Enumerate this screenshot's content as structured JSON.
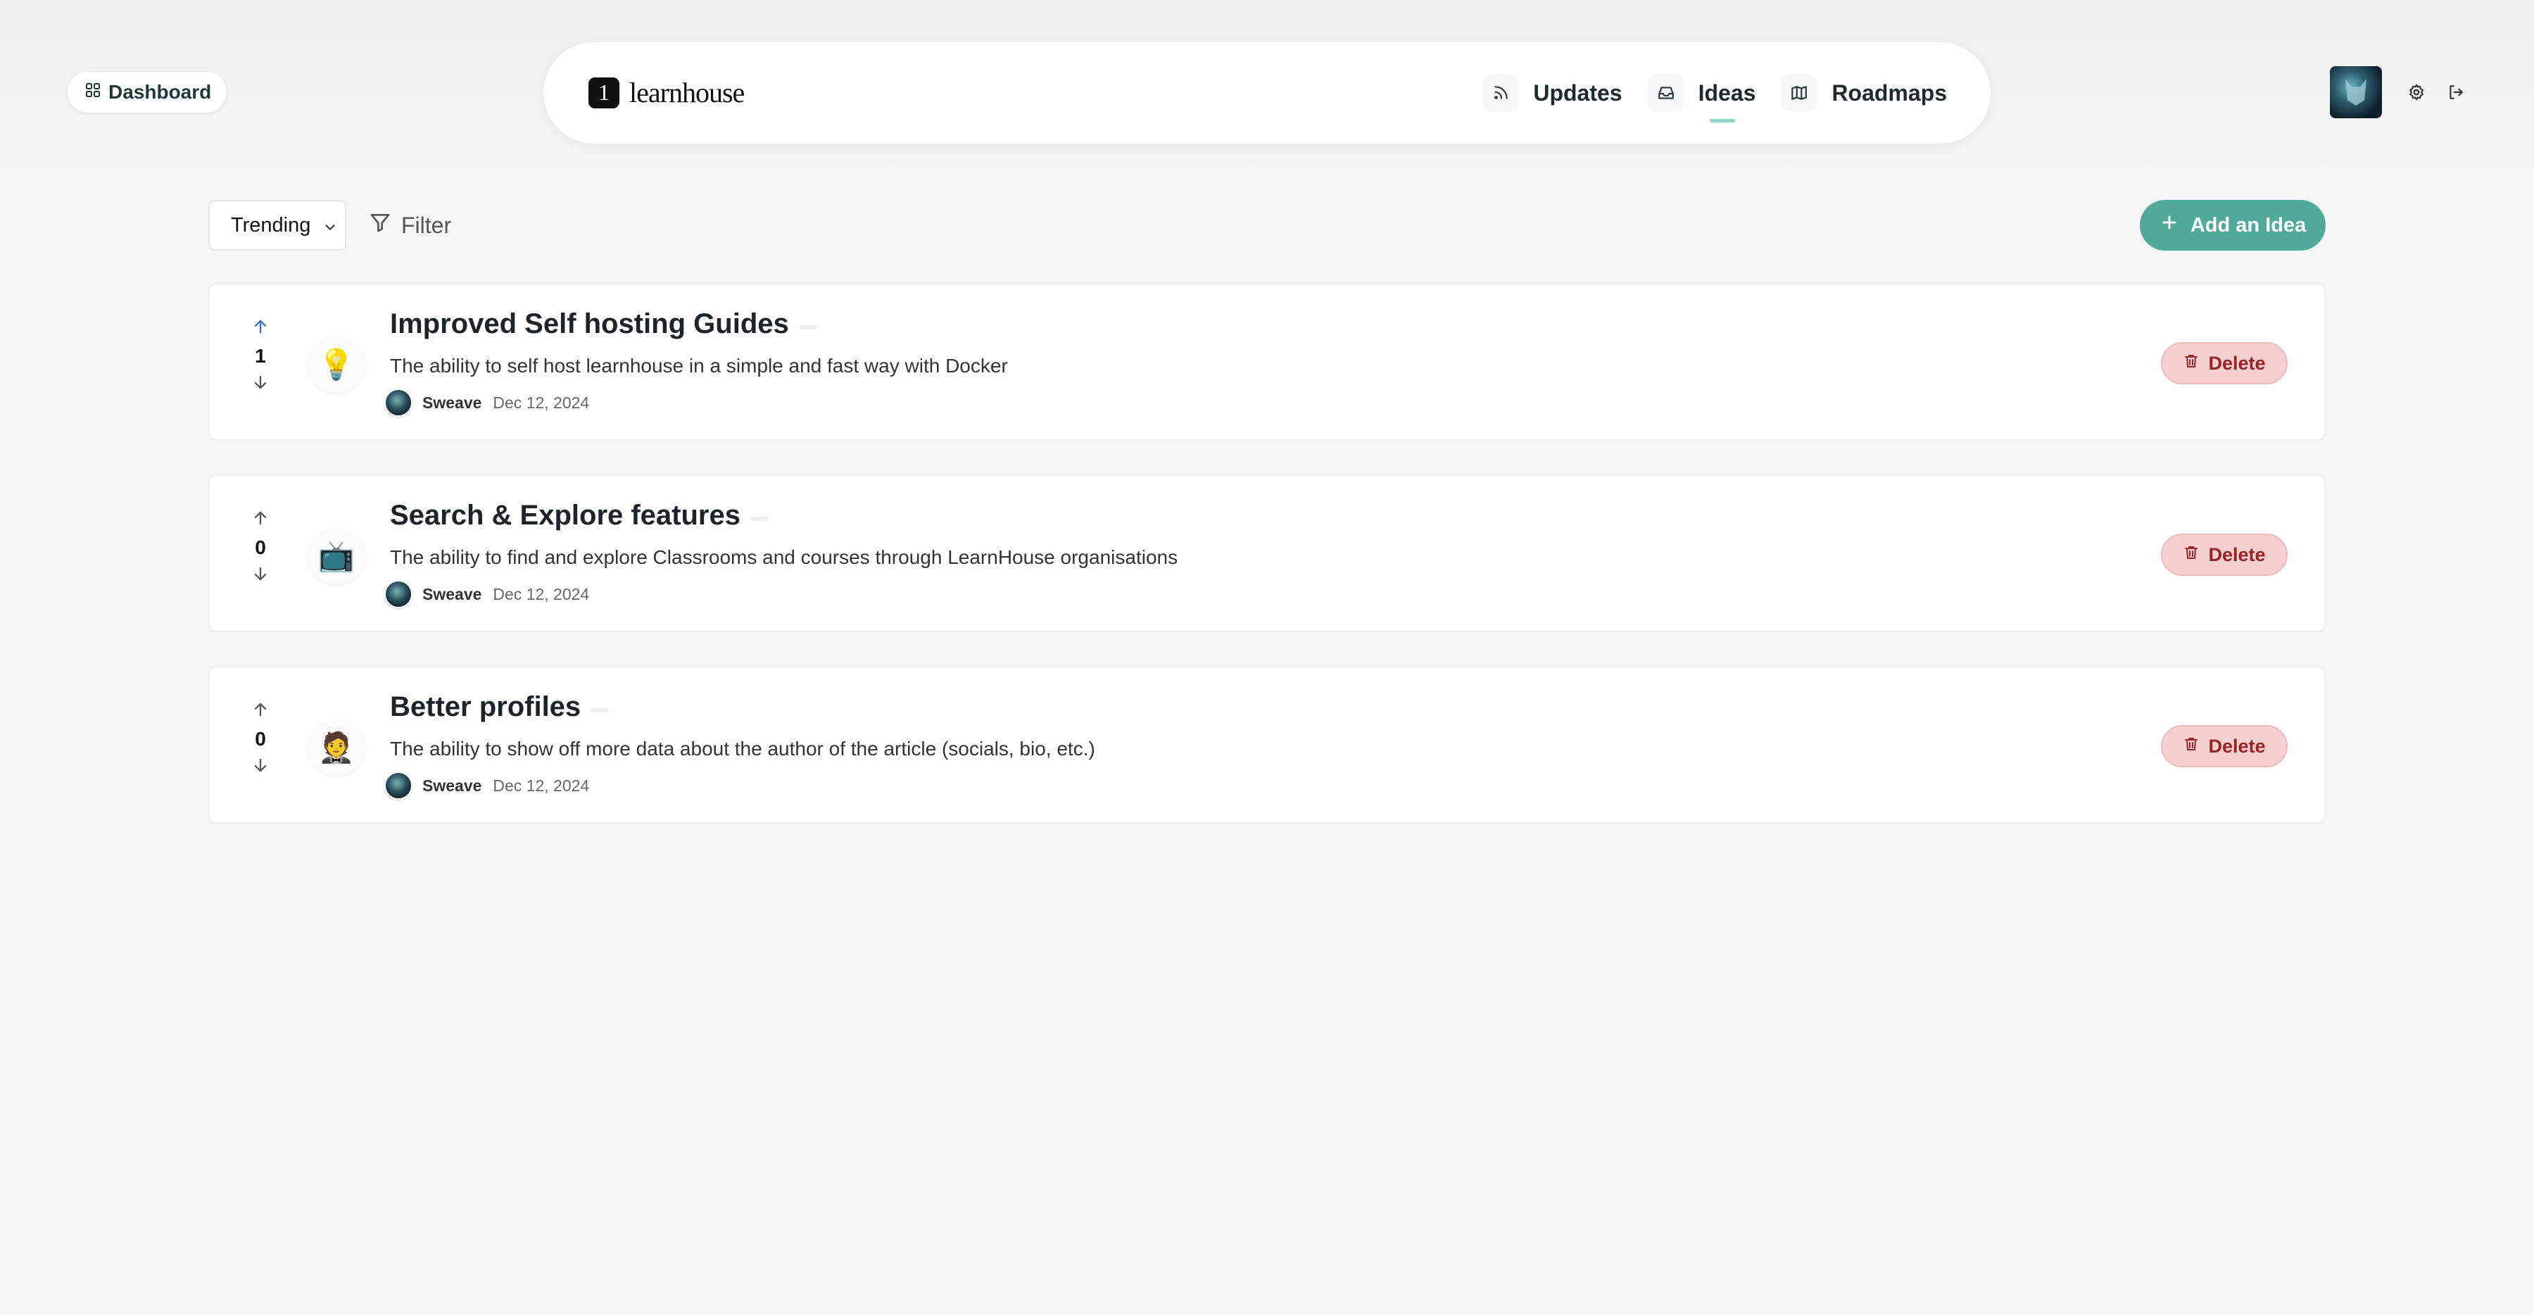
{
  "header": {
    "dashboard_label": "Dashboard",
    "brand": {
      "mark": "1",
      "name": "learnhouse"
    },
    "nav": [
      {
        "label": "Updates",
        "icon": "rss-icon",
        "active": false
      },
      {
        "label": "Ideas",
        "icon": "inbox-icon",
        "active": true
      },
      {
        "label": "Roadmaps",
        "icon": "map-icon",
        "active": false
      }
    ],
    "user_icons": [
      "avatar",
      "gear-icon",
      "logout-icon"
    ]
  },
  "toolbar": {
    "sort_value": "Trending",
    "filter_label": "Filter",
    "add_label": "Add an Idea"
  },
  "ideas": [
    {
      "votes": "1",
      "upvoted": true,
      "emoji": "💡",
      "title": "Improved Self hosting Guides",
      "description": "The ability to self host learnhouse in a simple and fast way with Docker",
      "author": "Sweave",
      "date": "Dec 12, 2024",
      "delete_label": "Delete"
    },
    {
      "votes": "0",
      "upvoted": false,
      "emoji": "📺",
      "title": "Search & Explore features",
      "description": "The ability to find and explore Classrooms and courses through LearnHouse organisations",
      "author": "Sweave",
      "date": "Dec 12, 2024",
      "delete_label": "Delete"
    },
    {
      "votes": "0",
      "upvoted": false,
      "emoji": "🤵",
      "title": "Better profiles",
      "description": "The ability to show off more data about the author of the article (socials, bio, etc.)",
      "author": "Sweave",
      "date": "Dec 12, 2024",
      "delete_label": "Delete"
    }
  ],
  "colors": {
    "accent": "#4faa9a",
    "upvote_active": "#3b6fd8",
    "delete_bg": "#f6cfcf",
    "delete_text": "#9b2222"
  }
}
